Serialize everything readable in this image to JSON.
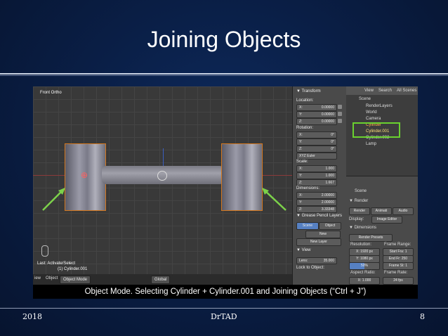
{
  "slide": {
    "title": "Joining Objects",
    "caption": "Object Mode. Selecting Cylinder + Cylinder.001 and Joining Objects (“Ctrl + J”)",
    "footer_left": "2018",
    "footer_center": "DrTAD",
    "footer_right": "8"
  },
  "viewport": {
    "label": "Front Ortho",
    "status_line1": "Last: Activate/Select",
    "status_line2": "(1) Cylinder.001"
  },
  "toolbar": {
    "view": "iew",
    "object": "Object",
    "mode": "Object Mode",
    "pivot": "Global"
  },
  "properties": {
    "transform": "▼ Transform",
    "location": "Location:",
    "loc_x_k": "X:",
    "loc_x_v": "0.00000",
    "loc_y_k": "Y:",
    "loc_y_v": "0.00000",
    "loc_z_k": "Z:",
    "loc_z_v": "0.00000",
    "rotation": "Rotation:",
    "rot_x_k": "X:",
    "rot_x_v": "0°",
    "rot_y_k": "Y:",
    "rot_y_v": "0°",
    "rot_z_k": "Z:",
    "rot_z_v": "0°",
    "euler": "XYZ Euler",
    "scale": "Scale:",
    "sc_x_k": "X:",
    "sc_x_v": "1.000",
    "sc_y_k": "Y:",
    "sc_y_v": "1.000",
    "sc_z_k": "Z:",
    "sc_z_v": "1.667",
    "dimensions": "Dimensions:",
    "dim_x_k": "X:",
    "dim_x_v": "2.00000",
    "dim_y_k": "Y:",
    "dim_y_v": "2.00000",
    "dim_z_k": "Z:",
    "dim_z_v": "3.33348",
    "grease": "▼ Grease Pencil Layers",
    "scene_btn": "Scene",
    "object_btn": "Object",
    "new_btn": "New",
    "new_layer": "New Layer",
    "view_hdr": "▼ View",
    "lens_k": "Lens:",
    "lens_v": "35.000",
    "lock_obj": "Lock to Object:"
  },
  "outliner": {
    "tab_view": "View",
    "tab_search": "Search",
    "tab_all": "All Scenes",
    "items": [
      "Scene",
      "RenderLayers",
      "World",
      "Camera",
      "Cylinder",
      "Cylinder.001",
      "Cylinder.002",
      "Lamp"
    ]
  },
  "render": {
    "scene": "Scene",
    "render_hdr": "▼ Render",
    "render_btn": "Render",
    "anim_btn": "Animati",
    "audio_btn": "Audio",
    "display_k": "Display:",
    "display_v": "Image Editor",
    "dimensions_hdr": "▼ Dimensions",
    "presets": "Render Presets",
    "resolution": "Resolution:",
    "frame_range": "Frame Range:",
    "res_x": "X: 1920 px",
    "res_y": "Y: 1080 px",
    "res_pct": "50%",
    "start": "Start Fra: 1",
    "end": "End Fr: 250",
    "step": "Frame St: 1",
    "aspect": "Aspect Ratio:",
    "frame_rate": "Frame Rate:",
    "asp_x": "X:    1.000",
    "fps": "24 fps"
  },
  "colors": {
    "background": "#0a1f47",
    "selection_outline": "#d4781f",
    "highlight_box": "#6ad12f",
    "arrow": "#7cd14a"
  }
}
